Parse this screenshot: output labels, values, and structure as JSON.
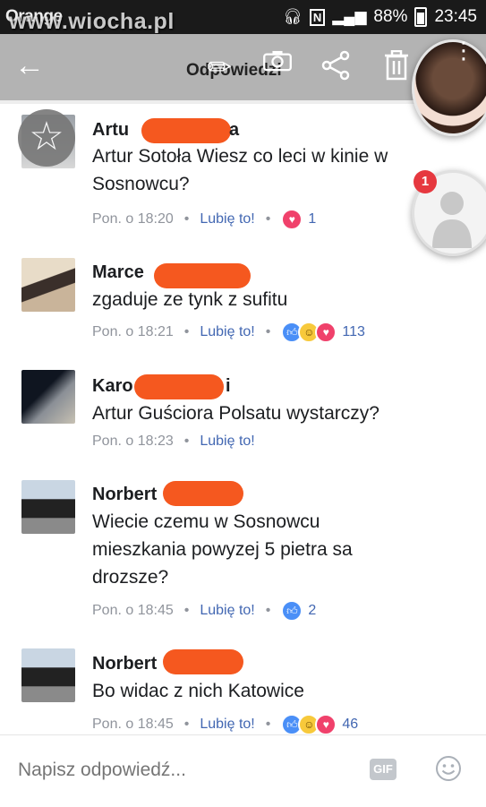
{
  "status_bar": {
    "carrier": "Orange",
    "watermark": "www.wiocha.pl",
    "signal_text": "⚡",
    "battery": "88%",
    "time": "23:45"
  },
  "header": {
    "title": "Odpowiedzi",
    "back_icon": "arrow-left-icon",
    "icons": [
      "edit-icon",
      "camera-icon",
      "share-icon",
      "trash-icon"
    ]
  },
  "chat_heads": {
    "badge_count": "1"
  },
  "comments": [
    {
      "name": "Artu",
      "name_suffix": "a",
      "text": "Artur Sotoła Wiesz co leci w kinie w Sosnowcu?",
      "time": "Pon. o 18:20",
      "like_label": "Lubię to!",
      "reactions": [
        "love"
      ],
      "count": "1"
    },
    {
      "name": "Marce",
      "name_suffix": "",
      "text": "zgaduje ze tynk z sufitu",
      "time": "Pon. o 18:21",
      "like_label": "Lubię to!",
      "reactions": [
        "like",
        "haha",
        "love"
      ],
      "count": "113"
    },
    {
      "name": "Karo",
      "name_suffix": "i",
      "text": "Artur Guściora Polsatu wystarczy?",
      "time": "Pon. o 18:23",
      "like_label": "Lubię to!",
      "reactions": [],
      "count": ""
    },
    {
      "name": "Norbert",
      "name_suffix": "",
      "text": "Wiecie czemu w Sosnowcu mieszkania powyzej 5 pietra sa drozsze?",
      "time": "Pon. o 18:45",
      "like_label": "Lubię to!",
      "reactions": [
        "like"
      ],
      "count": "2"
    },
    {
      "name": "Norbert",
      "name_suffix": "",
      "text": "Bo widac z nich Katowice",
      "time": "Pon. o 18:45",
      "like_label": "Lubię to!",
      "reactions": [
        "like",
        "haha",
        "love"
      ],
      "count": "46"
    }
  ],
  "composer": {
    "placeholder": "Napisz odpowiedź...",
    "gif_label": "GIF"
  },
  "colors": {
    "like_blue": "#4267b2",
    "redaction": "#f5581f",
    "meta_gray": "#90949c"
  }
}
